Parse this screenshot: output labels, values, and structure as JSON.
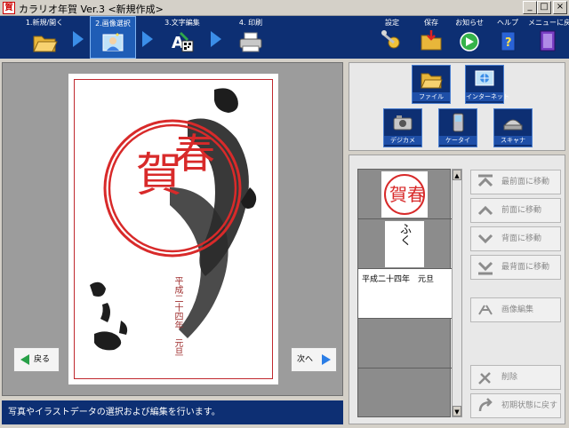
{
  "window": {
    "title": "カラリオ年賀 Ver.3 <新規作成>",
    "app_icon_text": "賀",
    "minimize": "_",
    "maximize": "□",
    "close": "×"
  },
  "toolbar": {
    "steps": [
      {
        "label": "1.新規/開く",
        "icon": "folder-open-icon"
      },
      {
        "label": "2.画像選択",
        "icon": "image-select-icon",
        "active": true
      },
      {
        "label": "3.文字編集",
        "icon": "text-edit-icon"
      },
      {
        "label": "4. 印刷",
        "icon": "printer-icon"
      }
    ],
    "right": [
      {
        "label": "設定",
        "icon": "settings-icon"
      },
      {
        "label": "保存",
        "icon": "save-folder-icon"
      },
      {
        "label": "お知らせ",
        "icon": "news-icon"
      },
      {
        "label": "ヘルプ",
        "icon": "help-book-icon"
      },
      {
        "label": "メニューに戻る",
        "icon": "menu-return-icon"
      }
    ]
  },
  "preview": {
    "back_label": "戻る",
    "next_label": "次へ",
    "card_text": "平成二十四年　元旦",
    "stamp_text": "賀春"
  },
  "status": {
    "message": "写真やイラストデータの選択および編集を行います。"
  },
  "sources": [
    {
      "label": "ファイル",
      "icon": "folder-icon"
    },
    {
      "label": "インターネット",
      "icon": "internet-icon"
    },
    {
      "label": "デジカメ",
      "icon": "digital-camera-icon"
    },
    {
      "label": "ケータイ",
      "icon": "mobile-phone-icon"
    },
    {
      "label": "スキャナ",
      "icon": "scanner-icon"
    }
  ],
  "layers": {
    "items": [
      {
        "type": "stamp",
        "text": "賀春"
      },
      {
        "type": "calligraphy",
        "text": "ふく"
      },
      {
        "type": "text",
        "text": "平成二十四年　元旦"
      },
      {
        "type": "empty"
      },
      {
        "type": "empty"
      }
    ],
    "scroll_up": "▲",
    "scroll_down": "▼"
  },
  "operations": {
    "bring_front": "最前面に移動",
    "forward": "前面に移動",
    "backward": "背面に移動",
    "send_back": "最背面に移動",
    "image_edit": "画像編集",
    "delete": "削除",
    "reset": "初期状態に戻す"
  }
}
